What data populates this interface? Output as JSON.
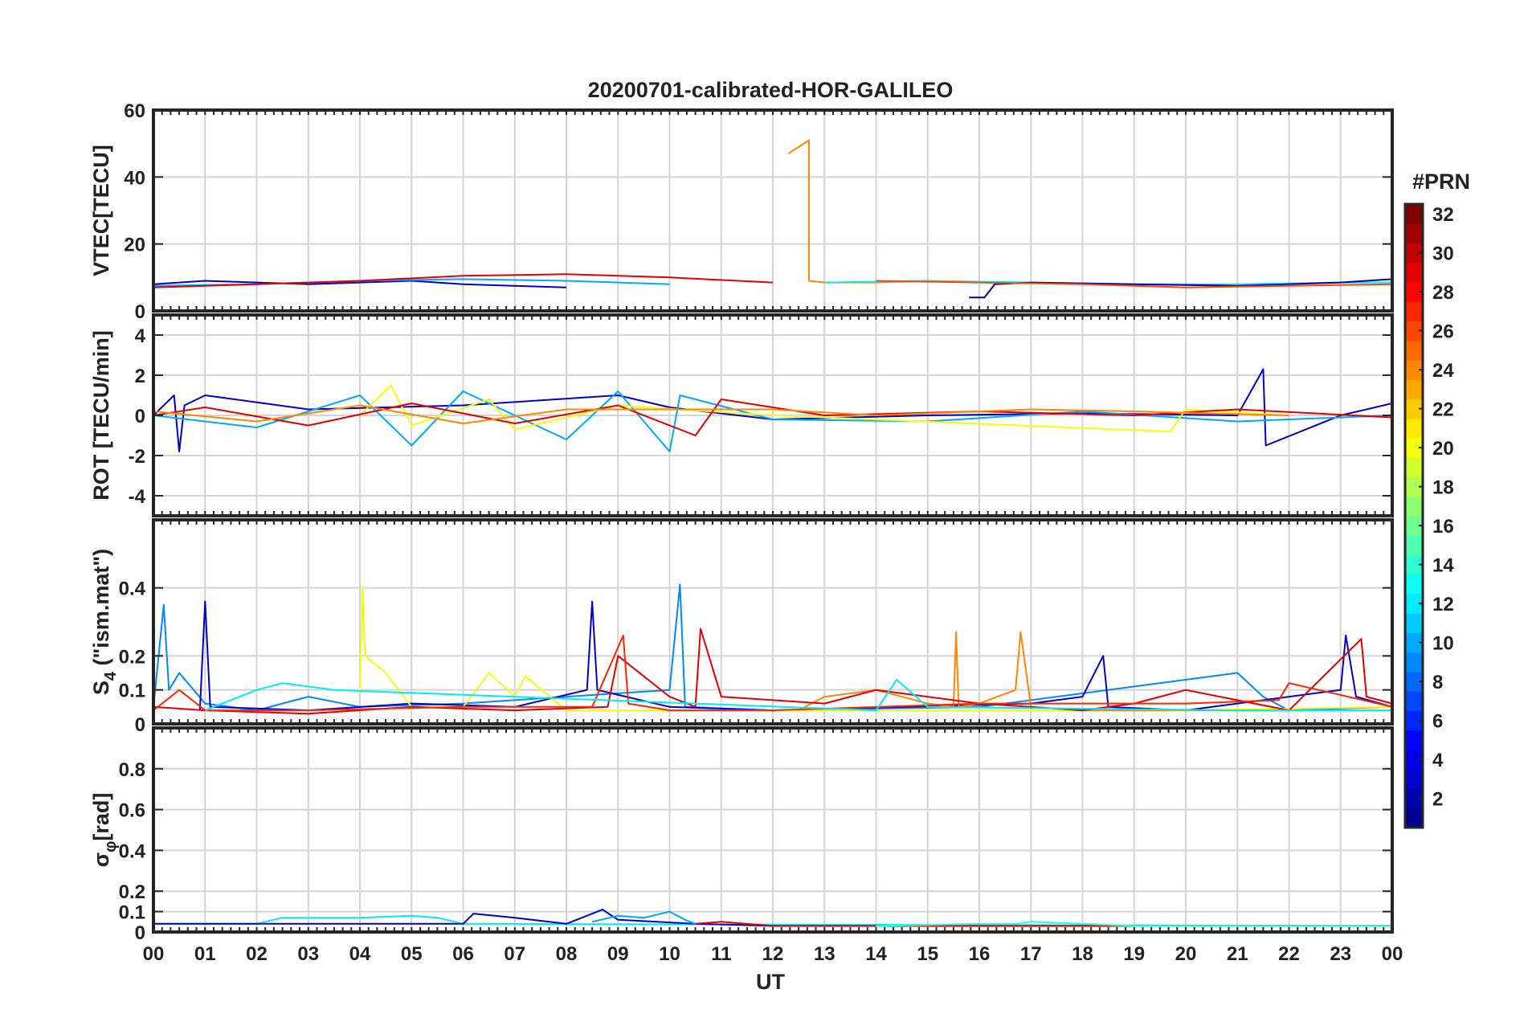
{
  "title": "20200701-calibrated-HOR-GALILEO",
  "xaxis": {
    "label": "UT",
    "tick_labels": [
      "00",
      "01",
      "02",
      "03",
      "04",
      "05",
      "06",
      "07",
      "08",
      "09",
      "10",
      "11",
      "12",
      "13",
      "14",
      "15",
      "16",
      "17",
      "18",
      "19",
      "20",
      "21",
      "22",
      "23",
      "00"
    ]
  },
  "colorbar": {
    "label": "#PRN",
    "range": [
      1,
      32
    ],
    "ticks": [
      2,
      4,
      6,
      8,
      10,
      12,
      14,
      16,
      18,
      20,
      22,
      24,
      26,
      28,
      30,
      32
    ],
    "colormap": "jet",
    "colors": [
      "#00008f",
      "#0000ff",
      "#0080ff",
      "#00ffff",
      "#80ff80",
      "#ffff00",
      "#ff8000",
      "#ff0000",
      "#800000"
    ]
  },
  "chart_data": [
    {
      "type": "line",
      "panel": "VTEC",
      "ylabel": "VTEC[TECU]",
      "ylim": [
        0,
        60
      ],
      "yticks": [
        0,
        20,
        40,
        60
      ],
      "xlim": [
        0,
        24
      ],
      "grid": true,
      "series": [
        {
          "prn": 3,
          "x": [
            0,
            1,
            2,
            3,
            4,
            5,
            6,
            7,
            8
          ],
          "y": [
            8,
            9,
            8.5,
            8,
            8.5,
            9,
            8,
            7.5,
            7
          ]
        },
        {
          "prn": 10,
          "x": [
            0,
            2,
            4,
            6,
            8,
            10
          ],
          "y": [
            7.5,
            8,
            9,
            9.5,
            9,
            8
          ]
        },
        {
          "prn": 29,
          "x": [
            0,
            2,
            4,
            6,
            8,
            10,
            12
          ],
          "y": [
            7,
            8,
            9,
            10.5,
            11,
            10,
            8.5
          ]
        },
        {
          "prn": 24,
          "x": [
            12.3,
            12.7,
            12.7,
            13,
            14,
            15
          ],
          "y": [
            47,
            51,
            9,
            8.5,
            8.5,
            9
          ]
        },
        {
          "prn": 12,
          "x": [
            13,
            15,
            17,
            19,
            21,
            23,
            24
          ],
          "y": [
            8.5,
            9,
            8.5,
            8,
            8,
            8.5,
            8.5
          ]
        },
        {
          "prn": 2,
          "x": [
            15.8,
            16.1,
            16.3,
            17,
            19,
            21,
            23,
            24
          ],
          "y": [
            4,
            4,
            8,
            8.5,
            8,
            7.5,
            8.5,
            9.5
          ]
        },
        {
          "prn": 26,
          "x": [
            14,
            16,
            18,
            20,
            22,
            24
          ],
          "y": [
            9,
            8.5,
            8,
            7,
            7.5,
            8
          ]
        }
      ]
    },
    {
      "type": "line",
      "panel": "ROT",
      "ylabel": "ROT [TECU/min]",
      "ylim": [
        -5,
        5
      ],
      "yticks": [
        -4,
        -2,
        0,
        2,
        4
      ],
      "xlim": [
        0,
        24
      ],
      "grid": true,
      "series": [
        {
          "prn": 3,
          "x": [
            0,
            0.4,
            0.5,
            0.6,
            1,
            3,
            6,
            9,
            10,
            12,
            15,
            18,
            21,
            21.5,
            21.55,
            23,
            24
          ],
          "y": [
            0,
            1,
            -1.8,
            0.5,
            1,
            0.3,
            0.5,
            1,
            0.4,
            -0.2,
            0,
            0.1,
            0,
            2.3,
            -1.5,
            0,
            0.6
          ]
        },
        {
          "prn": 10,
          "x": [
            0,
            2,
            4,
            5,
            6,
            8,
            9,
            10,
            10.2,
            12,
            15,
            18,
            21,
            24
          ],
          "y": [
            0,
            -0.6,
            1,
            -1.5,
            1.2,
            -1.2,
            1.2,
            -1.8,
            1,
            -0.2,
            -0.3,
            0.2,
            -0.3,
            0
          ]
        },
        {
          "prn": 20,
          "x": [
            4,
            4.6,
            5,
            6.5,
            7,
            9,
            12,
            19.7,
            20,
            22
          ],
          "y": [
            0,
            1.5,
            -0.5,
            0.8,
            -0.7,
            0.5,
            0,
            -0.8,
            0.3,
            0
          ]
        },
        {
          "prn": 29,
          "x": [
            0,
            1,
            3,
            5,
            7,
            9,
            10.5,
            11,
            13,
            16,
            19,
            21,
            24
          ],
          "y": [
            0,
            0.4,
            -0.5,
            0.6,
            -0.4,
            0.5,
            -1,
            0.8,
            0,
            0.2,
            0,
            0.3,
            -0.1
          ]
        },
        {
          "prn": 24,
          "x": [
            0,
            2,
            4,
            6,
            8,
            12,
            14,
            17,
            19,
            22
          ],
          "y": [
            0.2,
            -0.3,
            0.5,
            -0.4,
            0.3,
            0.3,
            0,
            0.3,
            0.2,
            0
          ]
        }
      ]
    },
    {
      "type": "line",
      "panel": "S4",
      "ylabel": "S4 (\"ism.mat\")",
      "ylabel_main": "S",
      "ylabel_sub": "4",
      "ylabel_rest": " (\"ism.mat\")",
      "ylim": [
        0,
        0.6
      ],
      "yticks": [
        0,
        0.1,
        0.2,
        0.4
      ],
      "xlim": [
        0,
        24
      ],
      "grid": true,
      "series": [
        {
          "prn": 9,
          "x": [
            0,
            0.2,
            0.3,
            0.5,
            1,
            2,
            3,
            4,
            6,
            8,
            10,
            10.2,
            10.3,
            12,
            16,
            21,
            21.5,
            22,
            24
          ],
          "y": [
            0.05,
            0.35,
            0.1,
            0.15,
            0.06,
            0.04,
            0.08,
            0.05,
            0.06,
            0.08,
            0.1,
            0.41,
            0.05,
            0.04,
            0.05,
            0.15,
            0.08,
            0.04,
            0.05
          ]
        },
        {
          "prn": 3,
          "x": [
            0.9,
            1,
            1.1,
            3,
            5,
            7,
            8.4,
            8.5,
            8.6,
            10,
            12,
            17,
            18,
            18.4,
            18.5,
            20,
            23,
            23.1,
            23.3,
            24
          ],
          "y": [
            0.04,
            0.36,
            0.05,
            0.04,
            0.06,
            0.05,
            0.1,
            0.36,
            0.1,
            0.05,
            0.04,
            0.06,
            0.08,
            0.2,
            0.05,
            0.04,
            0.1,
            0.26,
            0.08,
            0.05
          ]
        },
        {
          "prn": 20,
          "x": [
            4,
            4.05,
            4.1,
            4.5,
            5,
            6,
            6.5,
            7,
            7.2,
            8,
            20,
            24
          ],
          "y": [
            0.1,
            0.4,
            0.2,
            0.15,
            0.05,
            0.05,
            0.15,
            0.08,
            0.14,
            0.04,
            0.04,
            0.05
          ]
        },
        {
          "prn": 24,
          "x": [
            12.5,
            13,
            14,
            15,
            15.5,
            15.55,
            15.6,
            16,
            16.7,
            16.8,
            17,
            18,
            20,
            22
          ],
          "y": [
            0.04,
            0.08,
            0.1,
            0.06,
            0.05,
            0.27,
            0.05,
            0.06,
            0.1,
            0.27,
            0.05,
            0.04,
            0.04,
            0.04
          ]
        },
        {
          "prn": 29,
          "x": [
            0,
            1,
            3,
            5,
            7,
            8.8,
            9,
            10,
            10.5,
            10.6,
            11,
            13,
            14,
            16,
            18,
            19,
            19.5,
            20,
            22,
            23.4,
            23.5,
            24
          ],
          "y": [
            0.05,
            0.04,
            0.03,
            0.05,
            0.04,
            0.05,
            0.2,
            0.08,
            0.05,
            0.28,
            0.08,
            0.06,
            0.1,
            0.06,
            0.04,
            0.06,
            0.08,
            0.1,
            0.04,
            0.25,
            0.08,
            0.06
          ]
        },
        {
          "prn": 27,
          "x": [
            0,
            0.5,
            1,
            3,
            6,
            8.5,
            9.1,
            9.2,
            10,
            12,
            16,
            20,
            21.8,
            22,
            24
          ],
          "y": [
            0.04,
            0.1,
            0.04,
            0.04,
            0.05,
            0.05,
            0.26,
            0.06,
            0.04,
            0.04,
            0.06,
            0.06,
            0.07,
            0.12,
            0.05
          ]
        },
        {
          "prn": 12,
          "x": [
            1,
            2,
            2.5,
            3,
            3.5,
            14,
            14.4,
            15,
            21,
            24
          ],
          "y": [
            0.04,
            0.1,
            0.12,
            0.11,
            0.1,
            0.04,
            0.13,
            0.05,
            0.04,
            0.04
          ]
        }
      ]
    },
    {
      "type": "line",
      "panel": "SigmaPhi",
      "ylabel": "σφ[rad]",
      "ylabel_main": "σ",
      "ylabel_sub": "φ",
      "ylabel_rest": "[rad]",
      "ylim": [
        0,
        1
      ],
      "yticks": [
        0,
        0.1,
        0.2,
        0.4,
        0.6,
        0.8
      ],
      "xlim": [
        0,
        24
      ],
      "grid": true,
      "series": [
        {
          "prn": 12,
          "x": [
            0,
            2,
            2.5,
            4,
            5,
            5.5,
            6,
            24
          ],
          "y": [
            0.04,
            0.04,
            0.07,
            0.07,
            0.08,
            0.07,
            0.04,
            0.03
          ]
        },
        {
          "prn": 3,
          "x": [
            0,
            6,
            6.2,
            7,
            8,
            8.7,
            9,
            10.5,
            12,
            24
          ],
          "y": [
            0.04,
            0.04,
            0.09,
            0.07,
            0.04,
            0.11,
            0.06,
            0.04,
            0.03,
            0.03
          ]
        },
        {
          "prn": 10,
          "x": [
            8.5,
            9,
            9.5,
            10,
            10.3,
            10.5
          ],
          "y": [
            0.05,
            0.08,
            0.07,
            0.1,
            0.06,
            0.04
          ]
        },
        {
          "prn": 29,
          "x": [
            10.5,
            11,
            12,
            16,
            24
          ],
          "y": [
            0.04,
            0.05,
            0.03,
            0.03,
            0.03
          ]
        },
        {
          "prn": 14,
          "x": [
            14,
            16,
            16.7,
            17,
            18,
            19,
            24
          ],
          "y": [
            0.03,
            0.04,
            0.04,
            0.05,
            0.04,
            0.03,
            0.03
          ]
        }
      ]
    }
  ]
}
